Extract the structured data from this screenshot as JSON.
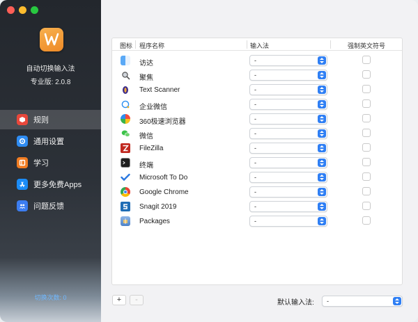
{
  "sidebar": {
    "app_title": "自动切换输入法",
    "app_version": "专业版: 2.0.8",
    "items": [
      {
        "label": "规则",
        "icon": "rules-icon",
        "color": "#e8473b",
        "active": true
      },
      {
        "label": "通用设置",
        "icon": "gear-icon",
        "color": "#2f8cf2",
        "active": false
      },
      {
        "label": "学习",
        "icon": "book-icon",
        "color": "#f07c22",
        "active": false
      },
      {
        "label": "更多免费Apps",
        "icon": "app-store-icon",
        "color": "#1b8cf7",
        "active": false
      },
      {
        "label": "问题反馈",
        "icon": "feedback-icon",
        "color": "#3c7df0",
        "active": false
      }
    ],
    "switch_count": "切换次数: 0"
  },
  "table": {
    "headers": {
      "icon": "图标",
      "name": "程序名称",
      "input_method": "输入法",
      "force_english": "强制英文符号"
    },
    "rows": [
      {
        "name": "访达",
        "icon": "finder-icon",
        "input_method": "-",
        "force_english": false
      },
      {
        "name": "聚焦",
        "icon": "spotlight-icon",
        "input_method": "-",
        "force_english": false
      },
      {
        "name": "Text Scanner",
        "icon": "text-scanner-icon",
        "input_method": "-",
        "force_english": false
      },
      {
        "name": "企业微信",
        "icon": "wecom-icon",
        "input_method": "-",
        "force_english": false
      },
      {
        "name": "360极速浏览器",
        "icon": "360-browser-icon",
        "input_method": "-",
        "force_english": false
      },
      {
        "name": "微信",
        "icon": "wechat-icon",
        "input_method": "-",
        "force_english": false
      },
      {
        "name": "FileZilla",
        "icon": "filezilla-icon",
        "input_method": "-",
        "force_english": false
      },
      {
        "name": "终端",
        "icon": "terminal-icon",
        "input_method": "-",
        "force_english": false
      },
      {
        "name": "Microsoft To Do",
        "icon": "todo-icon",
        "input_method": "-",
        "force_english": false
      },
      {
        "name": "Google Chrome",
        "icon": "chrome-icon",
        "input_method": "-",
        "force_english": false
      },
      {
        "name": "Snagit 2019",
        "icon": "snagit-icon",
        "input_method": "-",
        "force_english": false
      },
      {
        "name": "Packages",
        "icon": "packages-icon",
        "input_method": "-",
        "force_english": false
      }
    ]
  },
  "footer": {
    "add_label": "+",
    "remove_label": "-",
    "default_label": "默认输入法:",
    "default_value": "-"
  }
}
